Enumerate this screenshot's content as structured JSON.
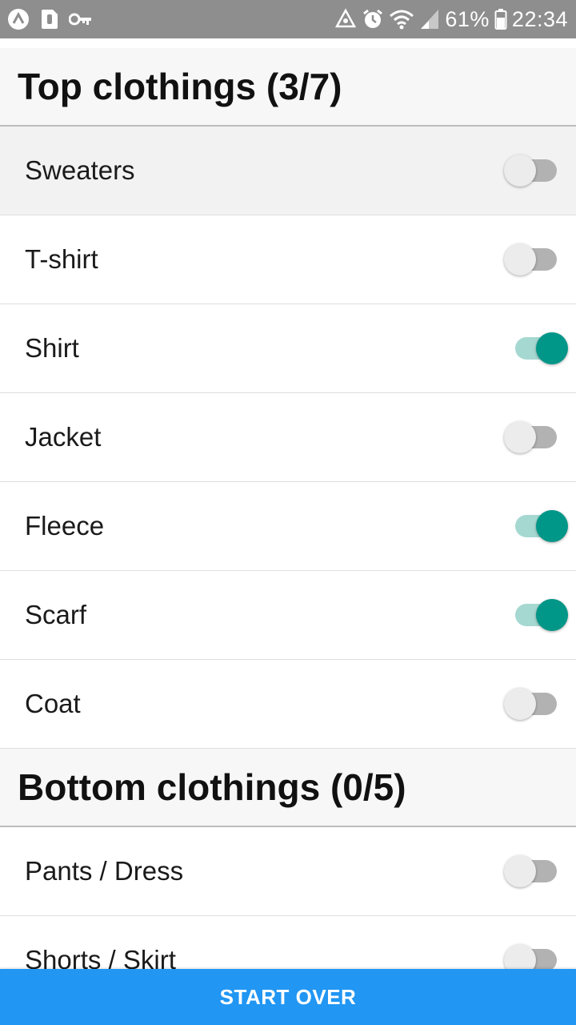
{
  "status_bar": {
    "icons_left": [
      "app-icon",
      "sim-icon",
      "vpn-key-icon"
    ],
    "icons_right": [
      "recycle-icon",
      "alarm-icon",
      "wifi-icon",
      "signal-icon",
      "battery-icon"
    ],
    "battery": "61%",
    "time": "22:34"
  },
  "sections": [
    {
      "title": "Top clothings (3/7)",
      "items": [
        {
          "label": "Sweaters",
          "on": false
        },
        {
          "label": "T-shirt",
          "on": false
        },
        {
          "label": "Shirt",
          "on": true
        },
        {
          "label": "Jacket",
          "on": false
        },
        {
          "label": "Fleece",
          "on": true
        },
        {
          "label": "Scarf",
          "on": true
        },
        {
          "label": "Coat",
          "on": false
        }
      ]
    },
    {
      "title": "Bottom clothings (0/5)",
      "items": [
        {
          "label": "Pants / Dress",
          "on": false
        },
        {
          "label": "Shorts / Skirt",
          "on": false
        }
      ]
    }
  ],
  "colors": {
    "accent": "#009688",
    "button": "#2196f3",
    "status_bar": "#8e8e8e"
  },
  "button": {
    "label": "START OVER"
  }
}
